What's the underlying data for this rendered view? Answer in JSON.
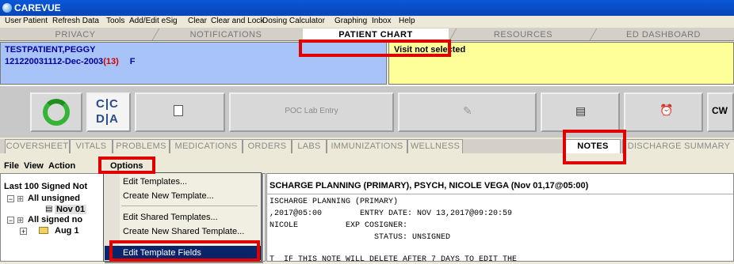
{
  "app": {
    "title": "CAREVUE"
  },
  "menubar": [
    "User",
    "Patient",
    "Refresh Data",
    "Tools",
    "Add/Edit eSig",
    "Clear",
    "Clear and Lock",
    "Dosing Calculator",
    "Graphing",
    "Inbox",
    "Help"
  ],
  "top_tabs": [
    "PRIVACY",
    "NOTIFICATIONS",
    "PATIENT CHART",
    "RESOURCES",
    "ED DASHBOARD"
  ],
  "patient": {
    "name": "TESTPATIENT,PEGGY",
    "id_dob": "121220031112-Dec-2003",
    "age": "(13)",
    "sex": "F"
  },
  "visit": {
    "text": "Visit not selected"
  },
  "toolbar": {
    "poc_label": "POC Lab Entry",
    "cw_label": "CW",
    "cc_top": "C|C",
    "cc_bottom": "D|A"
  },
  "sub_tabs": [
    "COVERSHEET",
    "VITALS",
    "PROBLEMS",
    "MEDICATIONS",
    "ORDERS",
    "LABS",
    "IMMUNIZATIONS",
    "WELLNESS",
    "NOTES",
    "DISCHARGE SUMMARY"
  ],
  "notes_menu": [
    "File",
    "View",
    "Action",
    "Options"
  ],
  "left_pane": {
    "header": "Last 100 Signed Not",
    "items": [
      "All unsigned",
      "Nov 01",
      "All signed no",
      "Aug 1"
    ]
  },
  "options_menu": {
    "items": [
      "Edit Templates...",
      "Create New Template...",
      "Edit Shared Templates...",
      "Create New Shared Template...",
      "Edit Template Fields"
    ]
  },
  "note": {
    "header": "SCHARGE PLANNING (PRIMARY), PSYCH, NICOLE VEGA  (Nov 01,17@05:00)",
    "lines": [
      "ISCHARGE PLANNING (PRIMARY)",
      ",2017@05:00        ENTRY DATE: NOV 13,2017@09:20:59",
      "NICOLE          EXP COSIGNER:",
      "                      STATUS: UNSIGNED",
      "",
      "T  IF THIS NOTE WILL DELETE AFTER 7 DAYS TO EDIT THE"
    ]
  }
}
